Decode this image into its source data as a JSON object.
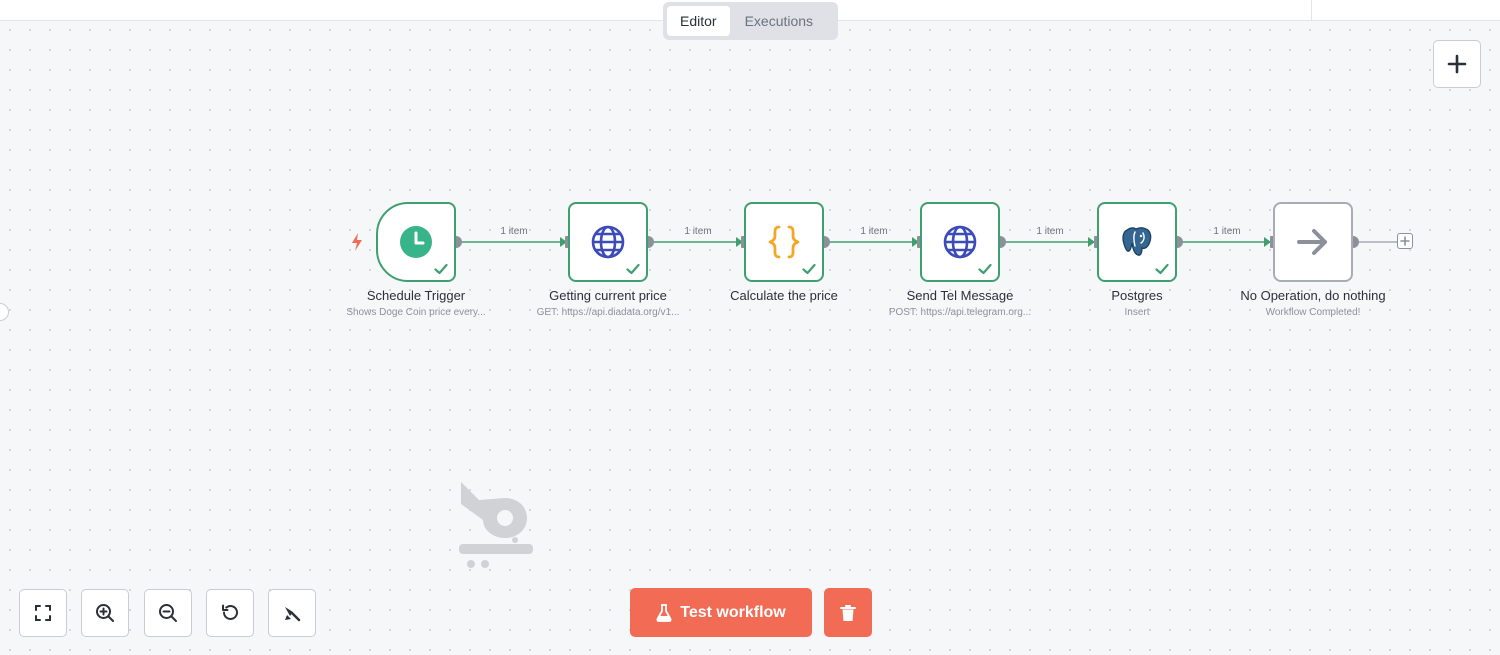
{
  "tabs": [
    {
      "label": "Editor",
      "active": true
    },
    {
      "label": "Executions",
      "active": false
    }
  ],
  "workflow": {
    "nodes": [
      {
        "title": "Schedule Trigger",
        "subtitle": "Shows Doge Coin price every...",
        "icon": "clock-icon",
        "status": "success"
      },
      {
        "title": "Getting current price",
        "subtitle": "GET: https://api.diadata.org/v1...",
        "icon": "globe-icon",
        "status": "success"
      },
      {
        "title": "Calculate the price",
        "subtitle": "",
        "icon": "code-braces-icon",
        "status": "success"
      },
      {
        "title": "Send Tel Message",
        "subtitle": "POST: https://api.telegram.org...",
        "icon": "globe-icon",
        "status": "success"
      },
      {
        "title": "Postgres",
        "subtitle": "Insert",
        "icon": "postgres-elephant-icon",
        "status": "success"
      },
      {
        "title": "No Operation, do nothing",
        "subtitle": "Workflow Completed!",
        "icon": "arrow-right-icon",
        "status": "none"
      }
    ],
    "connections": [
      {
        "label": "1 item"
      },
      {
        "label": "1 item"
      },
      {
        "label": "1 item"
      },
      {
        "label": "1 item"
      },
      {
        "label": "1 item"
      }
    ]
  },
  "actions": {
    "test_label": "Test workflow"
  },
  "controls": [
    "fit-view-icon",
    "zoom-in-icon",
    "zoom-out-icon",
    "reset-zoom-icon",
    "tidy-up-icon"
  ],
  "colors": {
    "success": "#3fa06f",
    "accent": "#f26b55",
    "trigger_bolt": "#f26b55",
    "code_icon": "#f5a623",
    "globe_icon": "#3b4bb8",
    "noop_border": "#a8acb4"
  }
}
